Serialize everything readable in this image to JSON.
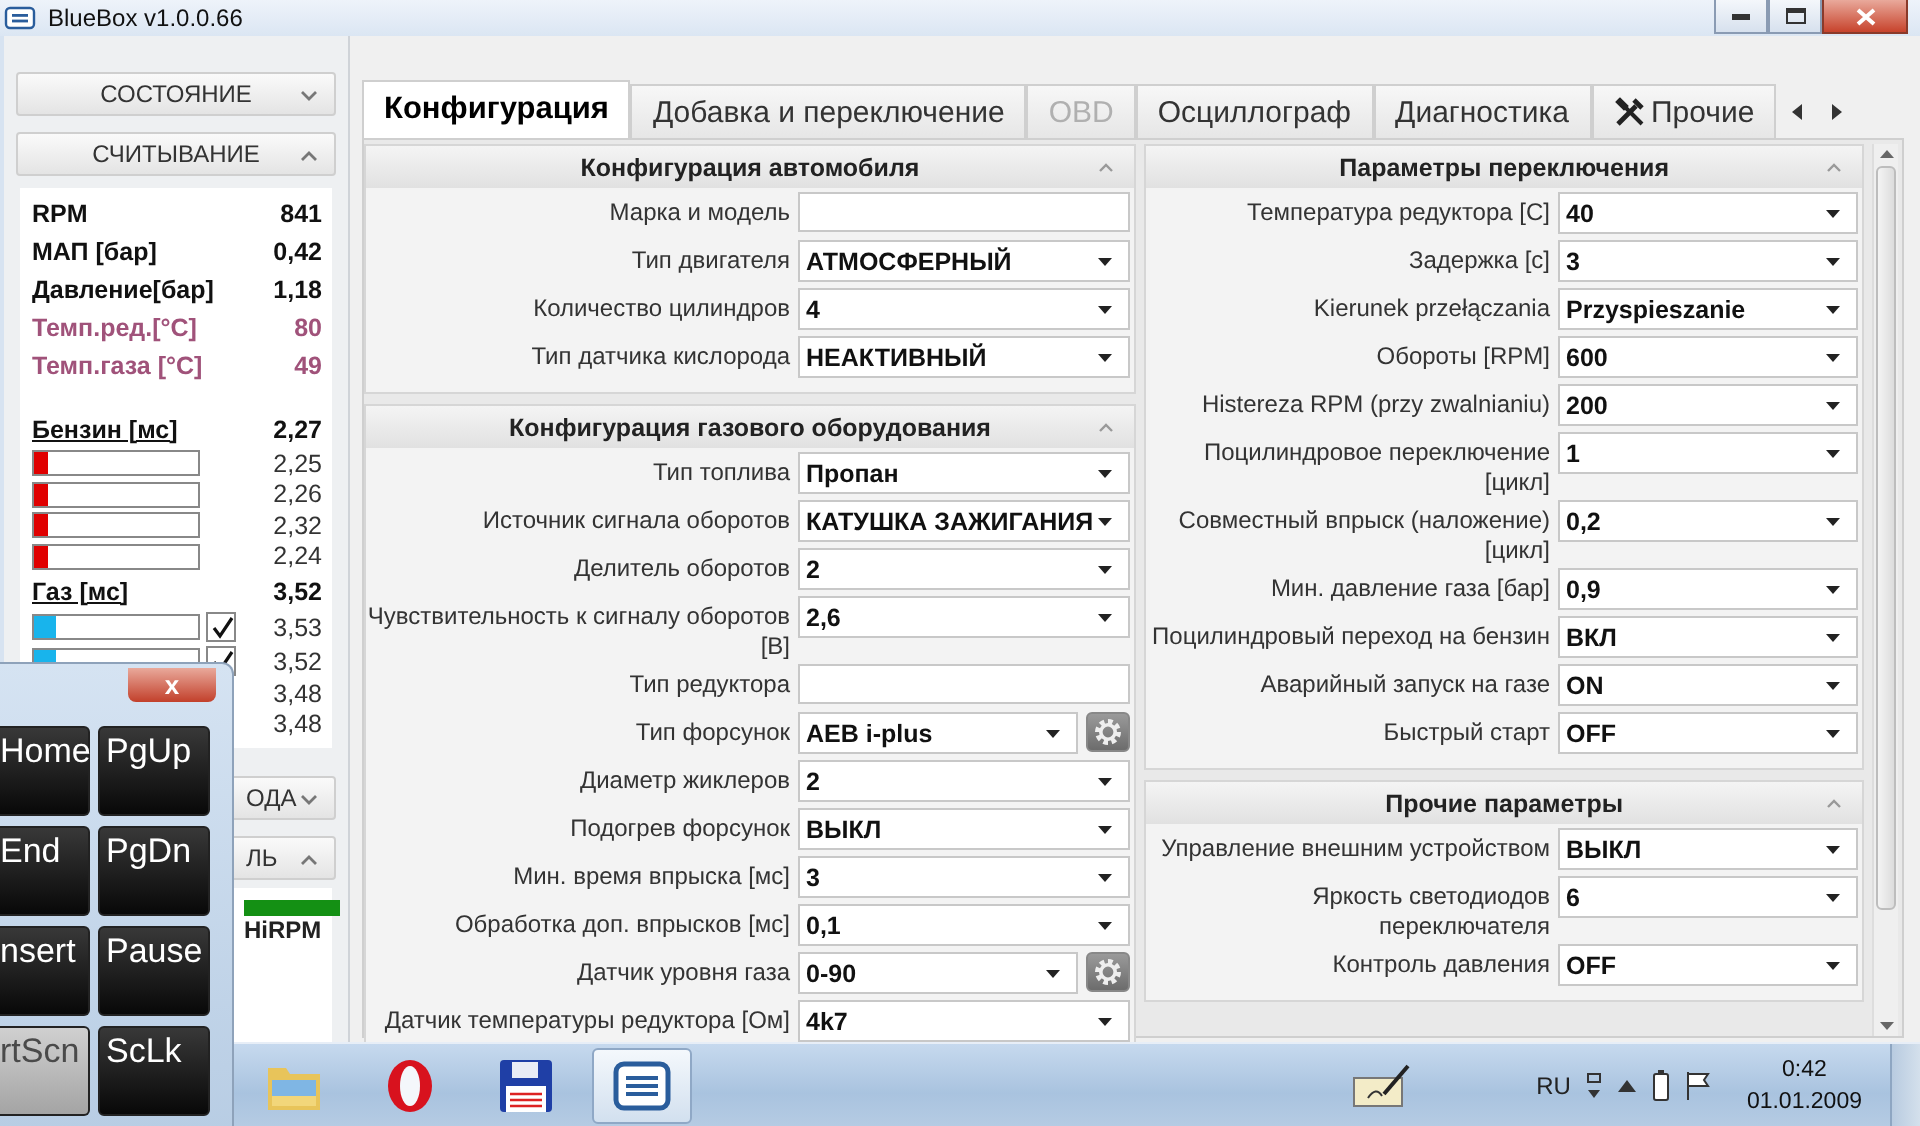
{
  "window": {
    "title": "BlueBox v1.0.0.66"
  },
  "sidebar": {
    "sections": [
      {
        "label": "СОСТОЯНИЕ",
        "expanded": false
      },
      {
        "label": "СЧИТЫВАНИЕ",
        "expanded": true
      }
    ],
    "readings": [
      {
        "kind": "value",
        "label": "RPM",
        "value": "841",
        "highlight": false
      },
      {
        "kind": "value",
        "label": "МАП [бар]",
        "value": "0,42",
        "highlight": false
      },
      {
        "kind": "value",
        "label": "Давление[бар]",
        "value": "1,18",
        "highlight": false
      },
      {
        "kind": "value",
        "label": "Темп.ред.[°C]",
        "value": "80",
        "highlight": true
      },
      {
        "kind": "value",
        "label": "Темп.газа [°C]",
        "value": "49",
        "highlight": true
      },
      {
        "kind": "header",
        "label": "Бензин [мс]",
        "value": "2,27"
      },
      {
        "kind": "bar",
        "level": 0.09,
        "color": "#e00000",
        "value": "2,25"
      },
      {
        "kind": "bar",
        "level": 0.09,
        "color": "#e00000",
        "value": "2,26"
      },
      {
        "kind": "bar",
        "level": 0.09,
        "color": "#e00000",
        "value": "2,32"
      },
      {
        "kind": "bar",
        "level": 0.09,
        "color": "#e00000",
        "value": "2,24"
      },
      {
        "kind": "header",
        "label": "Газ [мс]",
        "value": "3,52"
      },
      {
        "kind": "bar-check",
        "level": 0.13,
        "color": "#18b4ec",
        "checked": true,
        "value": "3,53"
      },
      {
        "kind": "bar-check",
        "level": 0.13,
        "color": "#18b4ec",
        "checked": true,
        "value": "3,52"
      },
      {
        "kind": "tail",
        "value": "3,48"
      },
      {
        "kind": "tail",
        "value": "3,48"
      }
    ],
    "lower_sections": [
      {
        "label": "ОДА",
        "expanded": false
      },
      {
        "label": "ЛЬ",
        "expanded": true
      }
    ],
    "indicator": {
      "label": "HiRPM",
      "on": true
    }
  },
  "tabs": [
    {
      "label": "Конфигурация",
      "selected": true,
      "disabled": false,
      "kind": "plain"
    },
    {
      "label": "Добавка и переключение",
      "selected": false,
      "disabled": false,
      "kind": "plain"
    },
    {
      "label": "OBD",
      "selected": false,
      "disabled": true,
      "kind": "plain"
    },
    {
      "label": "Осциллограф",
      "selected": false,
      "disabled": false,
      "kind": "plain"
    },
    {
      "label": "Диагностика",
      "selected": false,
      "disabled": false,
      "kind": "plain"
    },
    {
      "label": "Прочие",
      "selected": false,
      "disabled": false,
      "kind": "tools"
    }
  ],
  "columns": [
    [
      {
        "title": "Конфигурация автомобиля",
        "expanded": true,
        "rows": [
          {
            "label": "Марка и модель",
            "kind": "input"
          },
          {
            "label": "Тип двигателя",
            "kind": "select",
            "value": "АТМОСФЕРНЫЙ"
          },
          {
            "label": "Количество цилиндров",
            "kind": "select",
            "value": "4"
          },
          {
            "label": "Тип датчика кислорода",
            "kind": "select",
            "value": "НЕАКТИВНЫЙ"
          }
        ]
      },
      {
        "title": "Конфигурация газового оборудования",
        "expanded": true,
        "rows": [
          {
            "label": "Тип топлива",
            "kind": "select",
            "value": "Пропан"
          },
          {
            "label": "Источник сигнала оборотов",
            "kind": "select",
            "value": "КАТУШКА ЗАЖИГАНИЯ"
          },
          {
            "label": "Делитель оборотов",
            "kind": "select",
            "value": "2"
          },
          {
            "label": "Чувствительность к сигналу оборотов [В]",
            "kind": "select",
            "value": "2,6"
          },
          {
            "label": "Тип редуктора",
            "kind": "input"
          },
          {
            "label": "Тип форсунок",
            "kind": "select-config",
            "value": "AEB i-plus"
          },
          {
            "label": "Диаметр жиклеров",
            "kind": "select",
            "value": "2"
          },
          {
            "label": "Подогрев форсунок",
            "kind": "select",
            "value": "ВЫКЛ"
          },
          {
            "label": "Мин. время впрыска [мс]",
            "kind": "select",
            "value": "3"
          },
          {
            "label": "Обработка доп. впрысков [мс]",
            "kind": "select",
            "value": "0,1"
          },
          {
            "label": "Датчик уровня газа",
            "kind": "select-config",
            "value": "0-90"
          },
          {
            "label": "Датчик температуры редуктора [Ом]",
            "kind": "select",
            "value": "4k7"
          }
        ]
      }
    ],
    [
      {
        "title": "Параметры переключения",
        "expanded": true,
        "rows": [
          {
            "label": "Температура редуктора [C]",
            "kind": "select",
            "value": "40"
          },
          {
            "label": "Задержка [c]",
            "kind": "select",
            "value": "3"
          },
          {
            "label": "Kierunek przełączania",
            "kind": "select",
            "value": "Przyspieszanie"
          },
          {
            "label": "Обороты [RPM]",
            "kind": "select",
            "value": "600"
          },
          {
            "label": "Histereza RPM (przy zwalnianiu)",
            "kind": "select",
            "value": "200"
          },
          {
            "label": "Поцилиндровое переключение [цикл]",
            "kind": "select",
            "value": "1"
          },
          {
            "label": "Совместный впрыск (наложение) [цикл]",
            "kind": "select",
            "value": "0,2"
          },
          {
            "label": "Мин. давление газа [бар]",
            "kind": "select",
            "value": "0,9"
          },
          {
            "label": "Поцилиндровый переход на бензин",
            "kind": "select",
            "value": "ВКЛ"
          },
          {
            "label": "Аварийный запуск на газе",
            "kind": "select",
            "value": "ON"
          },
          {
            "label": "Быстрый старт",
            "kind": "select",
            "value": "OFF"
          }
        ]
      },
      {
        "title": "Прочие параметры",
        "expanded": true,
        "rows": [
          {
            "label": "Управление внешним устройством",
            "kind": "select",
            "value": "ВЫКЛ"
          },
          {
            "label": "Яркость светодиодов переключателя",
            "kind": "select",
            "value": "6"
          },
          {
            "label": "Контроль давления",
            "kind": "select",
            "value": "OFF"
          }
        ]
      }
    ]
  ],
  "keyboard": {
    "close": "x",
    "keys": [
      {
        "label": "Home",
        "disabled": false
      },
      {
        "label": "PgUp",
        "disabled": false
      },
      {
        "label": "End",
        "disabled": false
      },
      {
        "label": "PgDn",
        "disabled": false
      },
      {
        "label": "nsert",
        "disabled": false
      },
      {
        "label": "Pause",
        "disabled": false
      },
      {
        "label": "rtScn",
        "disabled": true
      },
      {
        "label": "ScLk",
        "disabled": false
      }
    ]
  },
  "taskbar": {
    "apps": [
      {
        "kind": "folder",
        "selected": false
      },
      {
        "kind": "ring",
        "selected": false
      },
      {
        "kind": "floppy",
        "selected": false
      },
      {
        "kind": "bluebox",
        "selected": true
      }
    ],
    "language": "RU",
    "time": "0:42",
    "date": "01.01.2009"
  }
}
